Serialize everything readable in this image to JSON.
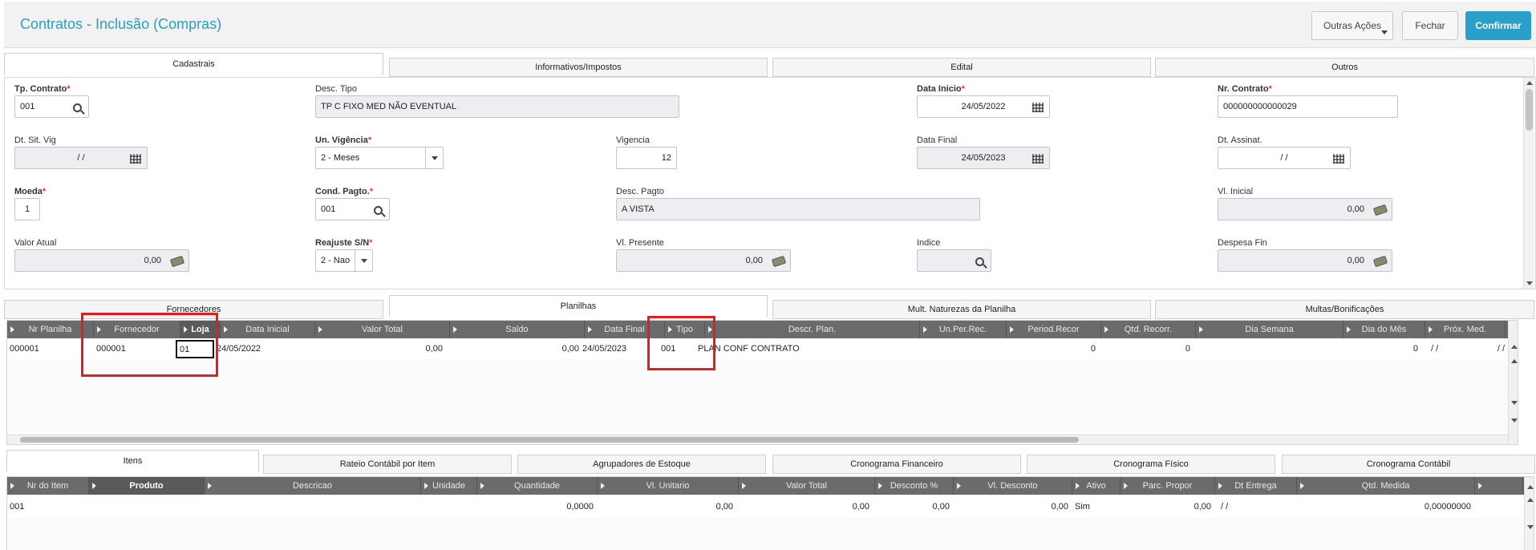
{
  "header": {
    "title": "Contratos - Inclusão (Compras)",
    "buttons": {
      "outras_acoes": "Outras Ações",
      "fechar": "Fechar",
      "confirmar": "Confirmar"
    }
  },
  "top_tabs": [
    "Cadastrais",
    "Informativos/Impostos",
    "Edital",
    "Outros"
  ],
  "form": {
    "tp_contrato": {
      "label": "Tp. Contrato",
      "value": "001"
    },
    "desc_tipo": {
      "label": "Desc. Tipo",
      "value": "TP C FIXO MED NÃO EVENTUAL"
    },
    "data_inicio": {
      "label": "Data Inicio",
      "value": "24/05/2022"
    },
    "nr_contrato": {
      "label": "Nr. Contrato",
      "value": "000000000000029"
    },
    "dt_sit_vig": {
      "label": "Dt. Sit. Vig",
      "value": "/ /"
    },
    "un_vigencia": {
      "label": "Un. Vigência",
      "value": "2 - Meses"
    },
    "vigencia": {
      "label": "Vigencia",
      "value": "12"
    },
    "data_final": {
      "label": "Data Final",
      "value": "24/05/2023"
    },
    "dt_assinat": {
      "label": "Dt. Assinat.",
      "value": "/ /"
    },
    "moeda": {
      "label": "Moeda",
      "value": "1"
    },
    "cond_pagto": {
      "label": "Cond. Pagto.",
      "value": "001"
    },
    "desc_pagto": {
      "label": "Desc. Pagto",
      "value": "A VISTA"
    },
    "vl_inicial": {
      "label": "Vl. Inicial",
      "value": "0,00"
    },
    "valor_atual": {
      "label": "Valor Atual",
      "value": "0,00"
    },
    "reajuste": {
      "label": "Reajuste S/N",
      "value": "2 - Nao"
    },
    "vl_presente": {
      "label": "Vl. Presente",
      "value": "0,00"
    },
    "indice": {
      "label": "Indice",
      "value": ""
    },
    "despesa_fin": {
      "label": "Despesa Fin",
      "value": "0,00"
    }
  },
  "mid_tabs": [
    "Fornecedores",
    "Planilhas",
    "Mult. Naturezas da Planilha",
    "Multas/Bonificações"
  ],
  "planilhas_grid": {
    "columns": [
      "Nr Planilha",
      "Fornecedor",
      "Loja",
      "Data Inicial",
      "Valor Total",
      "Saldo",
      "Data Final",
      "Tipo",
      "Descr. Plan.",
      "Un.Per.Rec.",
      "Period.Recor",
      "Qtd. Recorr.",
      "Dia Semana",
      "Dia do Mês",
      "Próx. Med."
    ],
    "row": [
      "000001",
      "000001",
      "01",
      "24/05/2022",
      "0,00",
      "0,00",
      "24/05/2023",
      "001",
      "PLAN CONF CONTRATO",
      "",
      "0",
      "0",
      "",
      "0",
      "/ /",
      "/ /"
    ]
  },
  "bottom_tabs": [
    "Itens",
    "Rateio Contábil por Item",
    "Agrupadores de Estoque",
    "Cronograma Financeiro",
    "Cronograma Físico",
    "Cronograma Contábil"
  ],
  "itens_grid": {
    "columns": [
      "Nr do Item",
      "Produto",
      "Descricao",
      "Unidade",
      "Quantidade",
      "Vl. Unitario",
      "Valor Total",
      "Desconto %",
      "Vl. Desconto",
      "Ativo",
      "Parc. Propor",
      "Dt Entrega",
      "Qtd. Medida"
    ],
    "row": [
      "001",
      "",
      "",
      "",
      "0,0000",
      "0,00",
      "0,00",
      "0,00",
      "0,00",
      "Sim",
      "0,00",
      "/ /",
      "0,00000000"
    ]
  },
  "colors": {
    "accent": "#2a9fc9",
    "highlight": "#e21f1f",
    "grid_header": "#6b6b6b"
  }
}
